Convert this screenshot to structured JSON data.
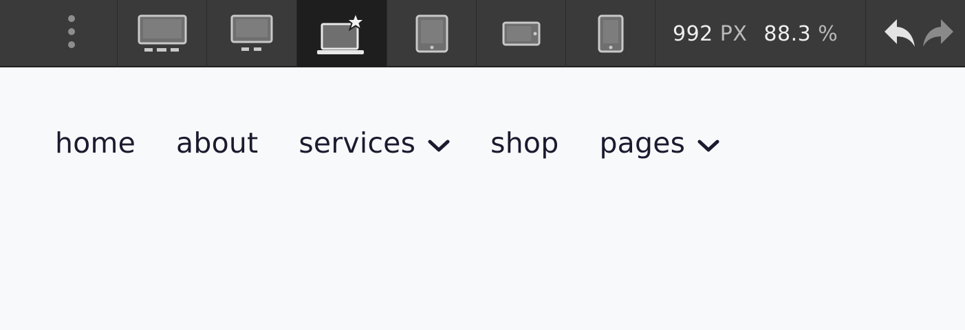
{
  "toolbar": {
    "icons": {
      "menu": "vertical-dots-icon",
      "devices": [
        {
          "name": "desktop-large-icon",
          "active": false
        },
        {
          "name": "desktop-icon",
          "active": false
        },
        {
          "name": "laptop-star-icon",
          "active": true
        },
        {
          "name": "tablet-icon",
          "active": false
        },
        {
          "name": "tablet-landscape-icon",
          "active": false
        },
        {
          "name": "phone-icon",
          "active": false
        }
      ],
      "undo": "undo-icon",
      "redo": "redo-icon"
    },
    "width_value": "992",
    "width_unit": "PX",
    "zoom_value": "88.3",
    "zoom_unit": "%"
  },
  "nav": {
    "items": [
      {
        "label": "home",
        "has_dropdown": false
      },
      {
        "label": "about",
        "has_dropdown": false
      },
      {
        "label": "services",
        "has_dropdown": true
      },
      {
        "label": "shop",
        "has_dropdown": false
      },
      {
        "label": "pages",
        "has_dropdown": true
      }
    ]
  },
  "colors": {
    "toolbar_bg": "#3a3a3a",
    "toolbar_active": "#1e1e1e",
    "icon_fill": "#7a7a7a",
    "icon_stroke": "#c9c9c9",
    "canvas_bg": "#f8f9fb",
    "nav_text": "#1a1b2e"
  }
}
